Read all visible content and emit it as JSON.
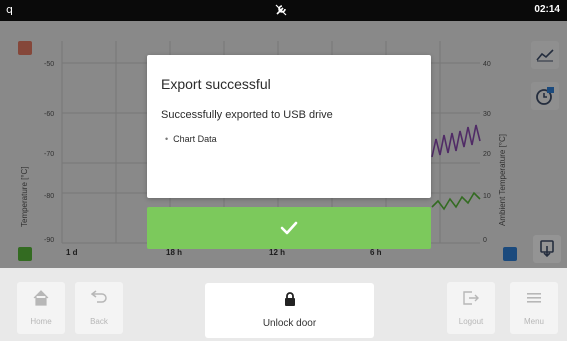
{
  "status_bar": {
    "left_glyph": "q",
    "center_icon": "wrench-off-icon",
    "time": "02:14"
  },
  "chart": {
    "left_axis_title": "Temperature [°C]",
    "right_axis_title": "Ambient Temperature [°C]",
    "left_ticks": [
      "-50",
      "-60",
      "-70",
      "-80",
      "-90"
    ],
    "right_ticks": [
      "40",
      "30",
      "20",
      "10",
      "0"
    ],
    "x_labels": [
      "1 d",
      "18 h",
      "12 h",
      "6 h"
    ],
    "colors": {
      "chamber": "#e57a64",
      "ambient_purple": "#8a4bb0",
      "ambient_green": "#58b83a",
      "accent": "#2f80d8"
    }
  },
  "side_icons": [
    "trend-chart-icon",
    "clock-history-icon",
    "export-icon"
  ],
  "dialog": {
    "title": "Export successful",
    "message": "Successfully exported to USB drive",
    "items": [
      "Chart Data"
    ],
    "confirm_icon": "checkmark-icon",
    "confirm_color": "#7cc95c"
  },
  "bottom_nav": {
    "home_label": "Home",
    "back_label": "Back",
    "unlock_label": "Unlock door",
    "logout_label": "Logout",
    "menu_label": "Menu"
  }
}
